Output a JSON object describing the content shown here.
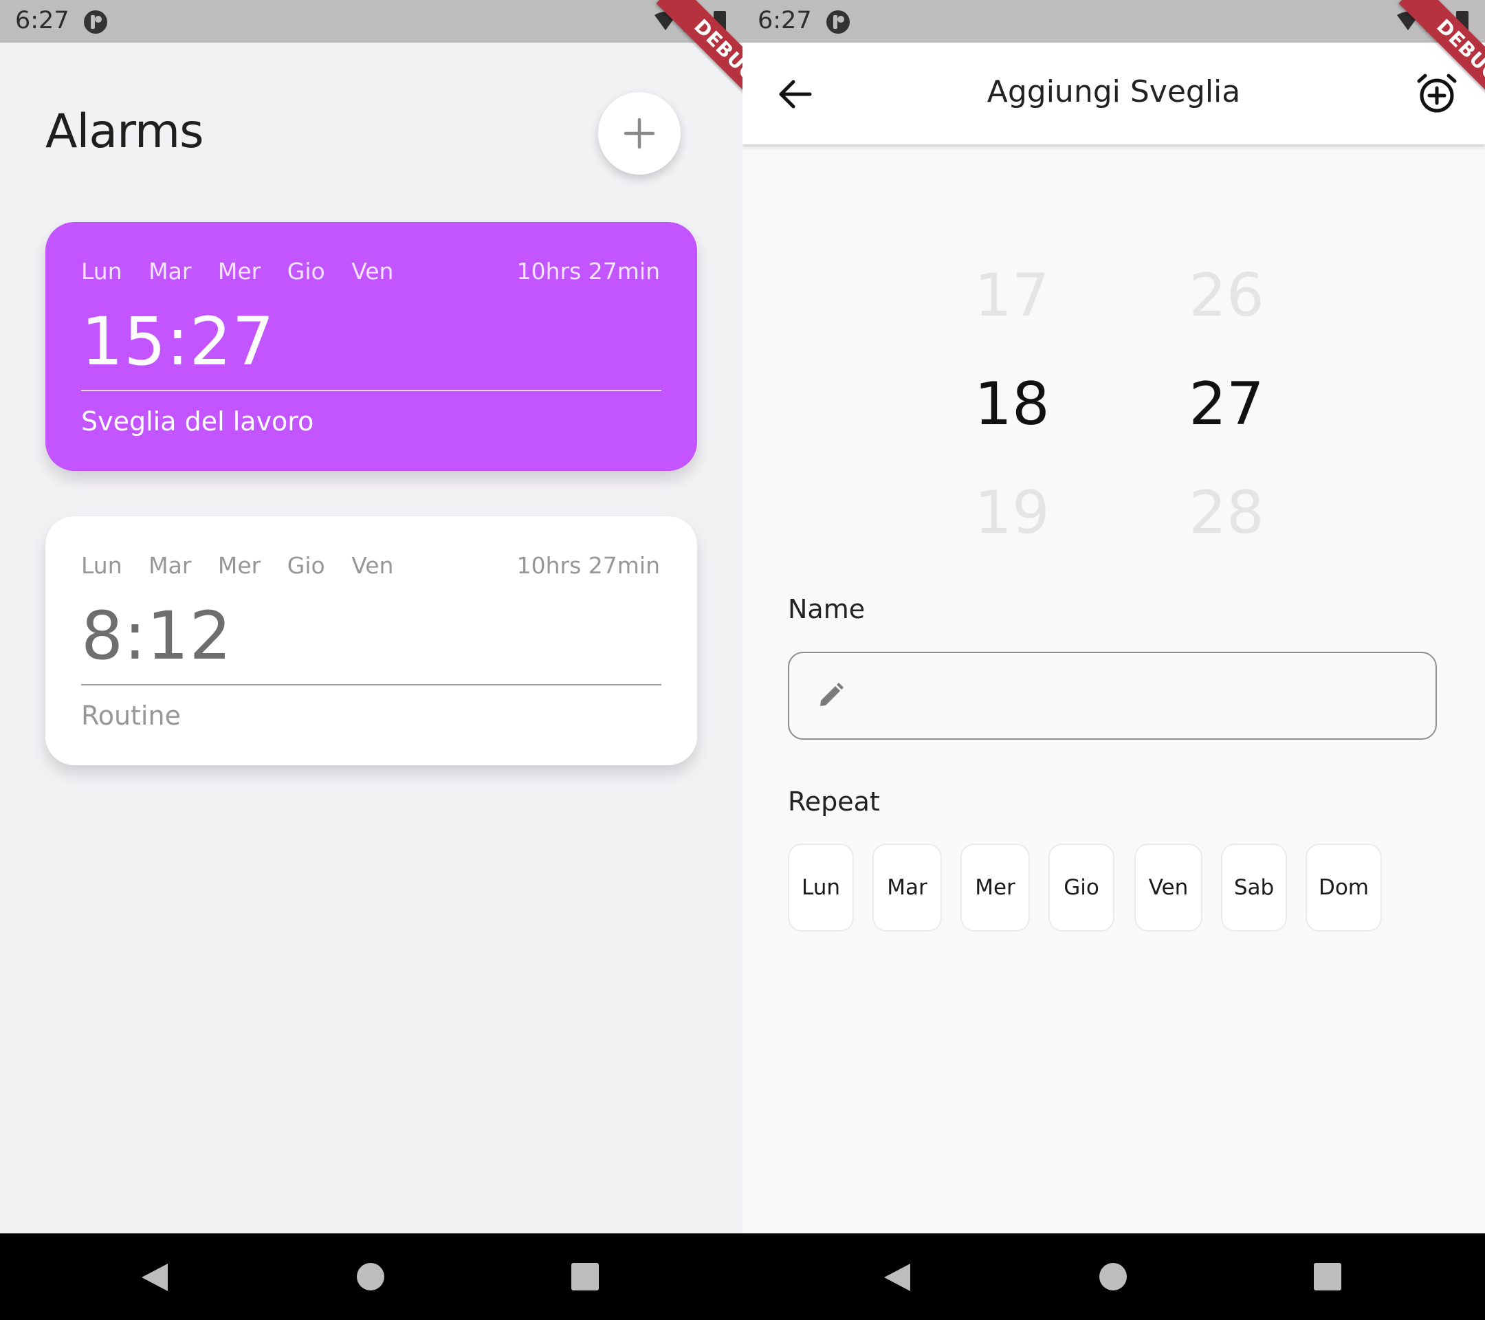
{
  "left": {
    "status": {
      "time": "6:27"
    },
    "debug_label": "DEBUG",
    "title": "Alarms",
    "add_icon": "plus-icon",
    "alarms": [
      {
        "days": [
          "Lun",
          "Mar",
          "Mer",
          "Gio",
          "Ven"
        ],
        "remaining": "10hrs 27min",
        "time": "15:27",
        "name": "Sveglia del lavoro",
        "color": "#c255ff"
      },
      {
        "days": [
          "Lun",
          "Mar",
          "Mer",
          "Gio",
          "Ven"
        ],
        "remaining": "10hrs 27min",
        "time": "8:12",
        "name": "Routine",
        "color": "#ffffff"
      }
    ]
  },
  "right": {
    "status": {
      "time": "6:27"
    },
    "debug_label": "DEBUG",
    "app_bar": {
      "title": "Aggiungi Sveglia",
      "back_icon": "arrow-left-icon",
      "action_icon": "alarm-add-icon"
    },
    "picker": {
      "hours": {
        "prev": "17",
        "selected": "18",
        "next": "19"
      },
      "minutes": {
        "prev": "26",
        "selected": "27",
        "next": "28"
      }
    },
    "name_label": "Name",
    "name_field": {
      "value": "",
      "icon": "pencil-icon"
    },
    "repeat_label": "Repeat",
    "repeat_days": [
      "Lun",
      "Mar",
      "Mer",
      "Gio",
      "Ven",
      "Sab",
      "Dom"
    ]
  }
}
